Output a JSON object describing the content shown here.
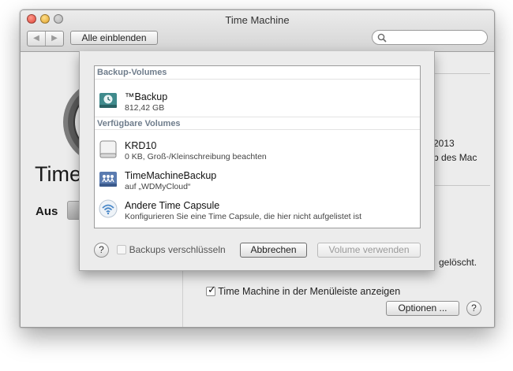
{
  "window": {
    "title": "Time Machine"
  },
  "toolbar": {
    "back": "◀",
    "forward": "▶",
    "show_all": "Alle einblenden",
    "search_placeholder": ""
  },
  "background": {
    "title": "Time",
    "switch_label": "Aus",
    "date_fragment": "2013",
    "mac_fragment": "b des Mac",
    "deleted_fragment": "gelöscht.",
    "menubar_label": "Time Machine in der Menüleiste anzeigen",
    "options_button": "Optionen ...",
    "help": "?"
  },
  "sheet": {
    "sections": [
      {
        "header": "Backup-Volumes",
        "items": [
          {
            "name": "™Backup",
            "detail": "812,42 GB",
            "icon": "time-machine-disk-icon"
          }
        ]
      },
      {
        "header": "Verfügbare Volumes",
        "items": [
          {
            "name": "KRD10",
            "detail": "0 KB, Groß-/Kleinschreibung beachten",
            "icon": "drive-icon"
          },
          {
            "name": "TimeMachineBackup",
            "detail": "auf „WDMyCloud“",
            "icon": "network-volume-icon"
          },
          {
            "name": "Andere Time Capsule",
            "detail": "Konfigurieren Sie eine Time Capsule, die hier nicht aufgelistet ist",
            "icon": "wifi-icon"
          }
        ]
      }
    ],
    "help": "?",
    "encrypt_label": "Backups verschlüsseln",
    "cancel_button": "Abbrechen",
    "use_volume_button": "Volume verwenden"
  },
  "colors": {
    "section_header": "#6f7d8c",
    "window_bg": "#ececec",
    "sheet_border": "#a7a7a7"
  }
}
